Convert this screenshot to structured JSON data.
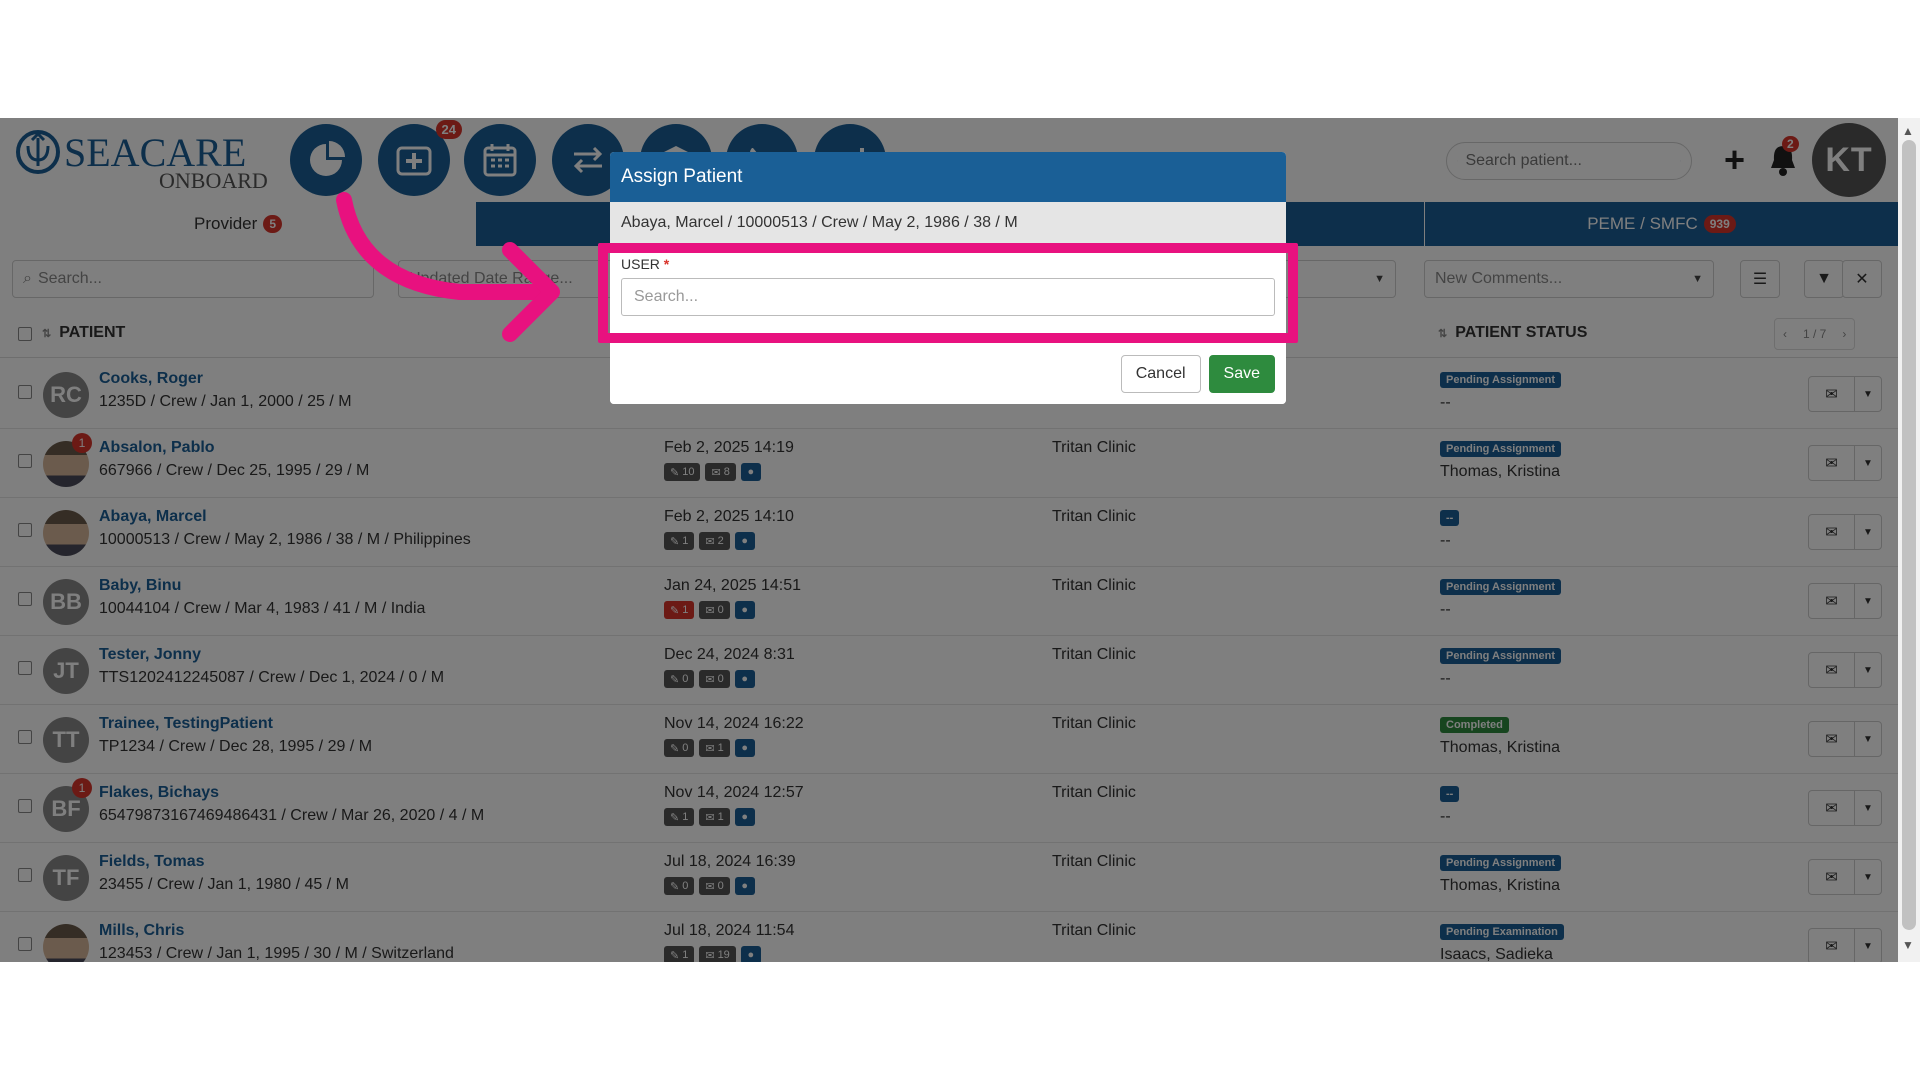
{
  "header": {
    "logo_text_main": "SEACARE",
    "logo_text_sub": "ONBOARD",
    "nav_badge": "24",
    "search_placeholder": "Search patient...",
    "bell_badge": "2",
    "user_initials": "KT"
  },
  "tabs": {
    "provider_label": "Provider",
    "provider_count": "5",
    "peme_label": "PEME / SMFC",
    "peme_count": "939"
  },
  "filters": {
    "search_placeholder": "Search...",
    "date_placeholder": "Updated Date Range...",
    "comments_placeholder": "New Comments..."
  },
  "table": {
    "col_patient": "PATIENT",
    "col_status": "PATIENT STATUS",
    "pager": {
      "prev": "‹",
      "page": "1 / 7",
      "next": "›"
    },
    "rows": [
      {
        "name": "Cooks, Roger",
        "info": "1235D / Crew / Jan 1, 2000 / 25 / M",
        "initials": "RC",
        "date": "",
        "clinic": "",
        "status": "Pending Assignment",
        "assignee": "--"
      },
      {
        "name": "Absalon, Pablo",
        "info": "667966 / Crew / Dec 25, 1995 / 29 / M",
        "initials": "",
        "badge": "1",
        "date": "Feb 2, 2025 14:19",
        "c1": "10",
        "c2": "8",
        "clinic": "Tritan Clinic",
        "status": "Pending Assignment",
        "assignee": "Thomas, Kristina"
      },
      {
        "name": "Abaya, Marcel",
        "info": "10000513 / Crew / May 2, 1986 / 38 / M / Philippines",
        "initials": "",
        "date": "Feb 2, 2025 14:10",
        "c1": "1",
        "c2": "2",
        "clinic": "Tritan Clinic",
        "status": "--",
        "assignee": "--"
      },
      {
        "name": "Baby, Binu",
        "info": "10044104 / Crew / Mar 4, 1983 / 41 / M / India",
        "initials": "BB",
        "date": "Jan 24, 2025 14:51",
        "c1": "1",
        "c2": "0",
        "clinic": "Tritan Clinic",
        "status": "Pending Assignment",
        "assignee": "--"
      },
      {
        "name": "Tester, Jonny",
        "info": "TTS1202412245087 / Crew / Dec 1, 2024 / 0 / M",
        "initials": "JT",
        "date": "Dec 24, 2024 8:31",
        "c1": "0",
        "c2": "0",
        "clinic": "Tritan Clinic",
        "status": "Pending Assignment",
        "assignee": "--"
      },
      {
        "name": "Trainee, TestingPatient",
        "info": "TP1234 / Crew / Dec 28, 1995 / 29 / M",
        "initials": "TT",
        "date": "Nov 14, 2024 16:22",
        "c1": "0",
        "c2": "1",
        "clinic": "Tritan Clinic",
        "status": "Completed",
        "assignee": "Thomas, Kristina"
      },
      {
        "name": "Flakes, Bichays",
        "info": "65479873167469486431 / Crew / Mar 26, 2020 / 4 / M",
        "initials": "BF",
        "badge": "1",
        "date": "Nov 14, 2024 12:57",
        "c1": "1",
        "c2": "1",
        "clinic": "Tritan Clinic",
        "status": "--",
        "assignee": "--"
      },
      {
        "name": "Fields, Tomas",
        "info": "23455 / Crew / Jan 1, 1980 / 45 / M",
        "initials": "TF",
        "date": "Jul 18, 2024 16:39",
        "c1": "0",
        "c2": "0",
        "clinic": "Tritan Clinic",
        "status": "Pending Assignment",
        "assignee": "Thomas, Kristina"
      },
      {
        "name": "Mills, Chris",
        "info": "123453 / Crew / Jan 1, 1995 / 30 / M / Switzerland",
        "initials": "",
        "date": "Jul 18, 2024 11:54",
        "c1": "1",
        "c2": "19",
        "clinic": "Tritan Clinic",
        "status": "Pending Examination",
        "assignee": "Isaacs, Sadieka"
      }
    ]
  },
  "modal": {
    "title": "Assign Patient",
    "subtitle": "Abaya, Marcel / 10000513 / Crew / May 2, 1986 / 38 / M",
    "user_label": "USER",
    "required_mark": "*",
    "user_placeholder": "Search...",
    "cancel_label": "Cancel",
    "save_label": "Save"
  },
  "colors": {
    "brand": "#1a5f96",
    "highlight": "#e8117f",
    "save": "#2e8b3e",
    "badge": "#d9342b"
  }
}
